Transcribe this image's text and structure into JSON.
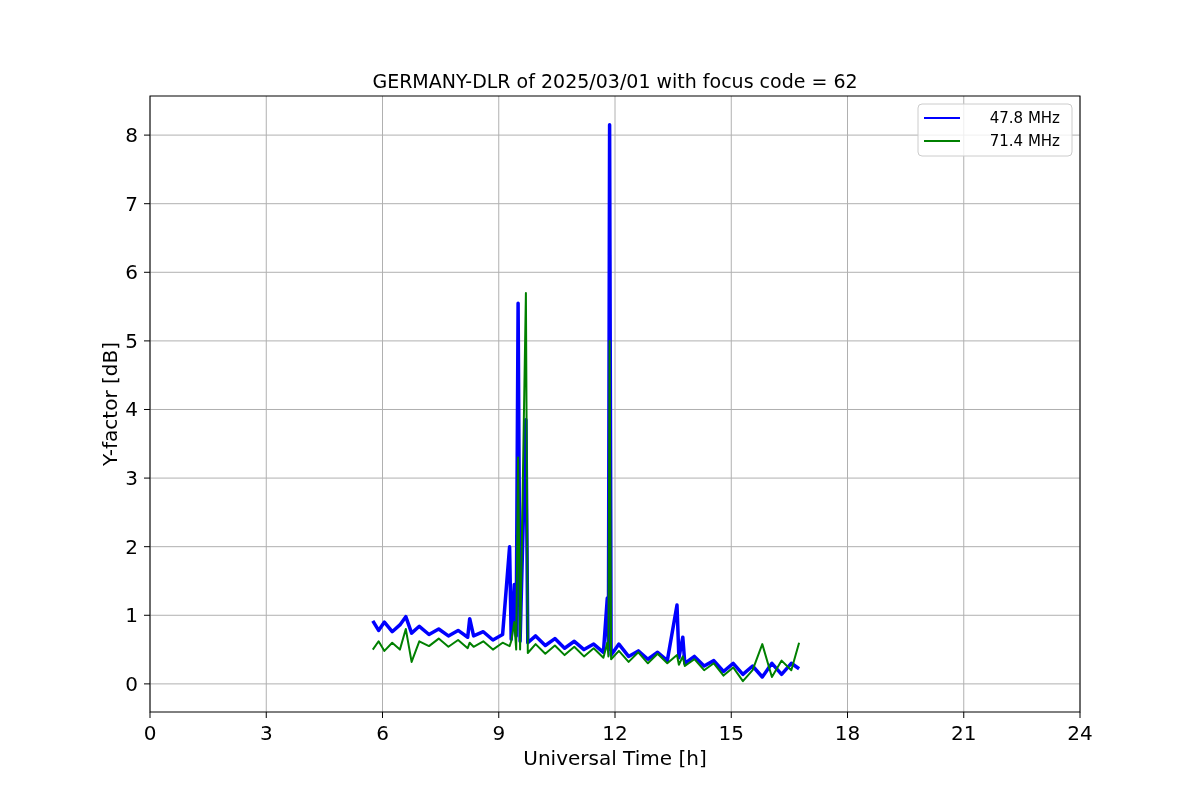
{
  "figure": {
    "chart_data": {
      "type": "line",
      "title": "GERMANY-DLR of 2025/03/01 with focus code = 62",
      "xlabel": "Universal Time [h]",
      "ylabel": "Y-factor [dB]",
      "x": [
        5.75,
        5.9,
        6.05,
        6.25,
        6.45,
        6.6,
        6.75,
        6.95,
        7.2,
        7.45,
        7.7,
        7.95,
        8.2,
        8.25,
        8.35,
        8.6,
        8.85,
        9.1,
        9.28,
        9.32,
        9.4,
        9.45,
        9.5,
        9.55,
        9.7,
        9.75,
        9.95,
        10.2,
        10.45,
        10.7,
        10.95,
        11.2,
        11.45,
        11.7,
        11.8,
        11.83,
        11.86,
        11.9,
        12.1,
        12.35,
        12.6,
        12.85,
        13.1,
        13.35,
        13.6,
        13.65,
        13.75,
        13.8,
        14.05,
        14.3,
        14.55,
        14.8,
        15.05,
        15.3,
        15.55,
        15.8,
        16.05,
        16.3,
        16.55,
        16.75
      ],
      "series": [
        {
          "name": "47.8 MHz",
          "color": "#0000ff",
          "values": [
            0.92,
            0.78,
            0.9,
            0.76,
            0.86,
            0.98,
            0.74,
            0.84,
            0.72,
            0.8,
            0.7,
            0.78,
            0.68,
            0.95,
            0.7,
            0.76,
            0.64,
            0.72,
            2.0,
            0.65,
            1.45,
            0.7,
            5.55,
            0.62,
            3.85,
            0.6,
            0.7,
            0.56,
            0.66,
            0.52,
            0.62,
            0.5,
            0.58,
            0.46,
            1.25,
            0.5,
            8.15,
            0.42,
            0.58,
            0.4,
            0.48,
            0.36,
            0.46,
            0.34,
            1.15,
            0.38,
            0.68,
            0.3,
            0.4,
            0.26,
            0.34,
            0.18,
            0.3,
            0.14,
            0.26,
            0.1,
            0.3,
            0.14,
            0.3,
            0.22
          ]
        },
        {
          "name": "71.4 MHz",
          "color": "#008000",
          "values": [
            0.5,
            0.62,
            0.48,
            0.6,
            0.5,
            0.8,
            0.32,
            0.62,
            0.55,
            0.66,
            0.54,
            0.64,
            0.52,
            0.6,
            0.54,
            0.62,
            0.5,
            0.6,
            0.55,
            0.62,
            0.9,
            0.5,
            3.3,
            0.5,
            5.7,
            0.45,
            0.58,
            0.44,
            0.56,
            0.42,
            0.54,
            0.4,
            0.52,
            0.38,
            0.6,
            0.4,
            5.0,
            0.36,
            0.48,
            0.32,
            0.46,
            0.3,
            0.44,
            0.3,
            0.42,
            0.28,
            0.4,
            0.26,
            0.36,
            0.2,
            0.3,
            0.12,
            0.24,
            0.04,
            0.2,
            0.58,
            0.1,
            0.34,
            0.2,
            0.6
          ]
        }
      ],
      "xlim": [
        0,
        24
      ],
      "ylim": [
        -0.41,
        8.57
      ],
      "xticks": [
        0,
        3,
        6,
        9,
        12,
        15,
        18,
        21,
        24
      ],
      "yticks": [
        0,
        1,
        2,
        3,
        4,
        5,
        6,
        7,
        8
      ],
      "grid": true,
      "legend": true
    }
  }
}
